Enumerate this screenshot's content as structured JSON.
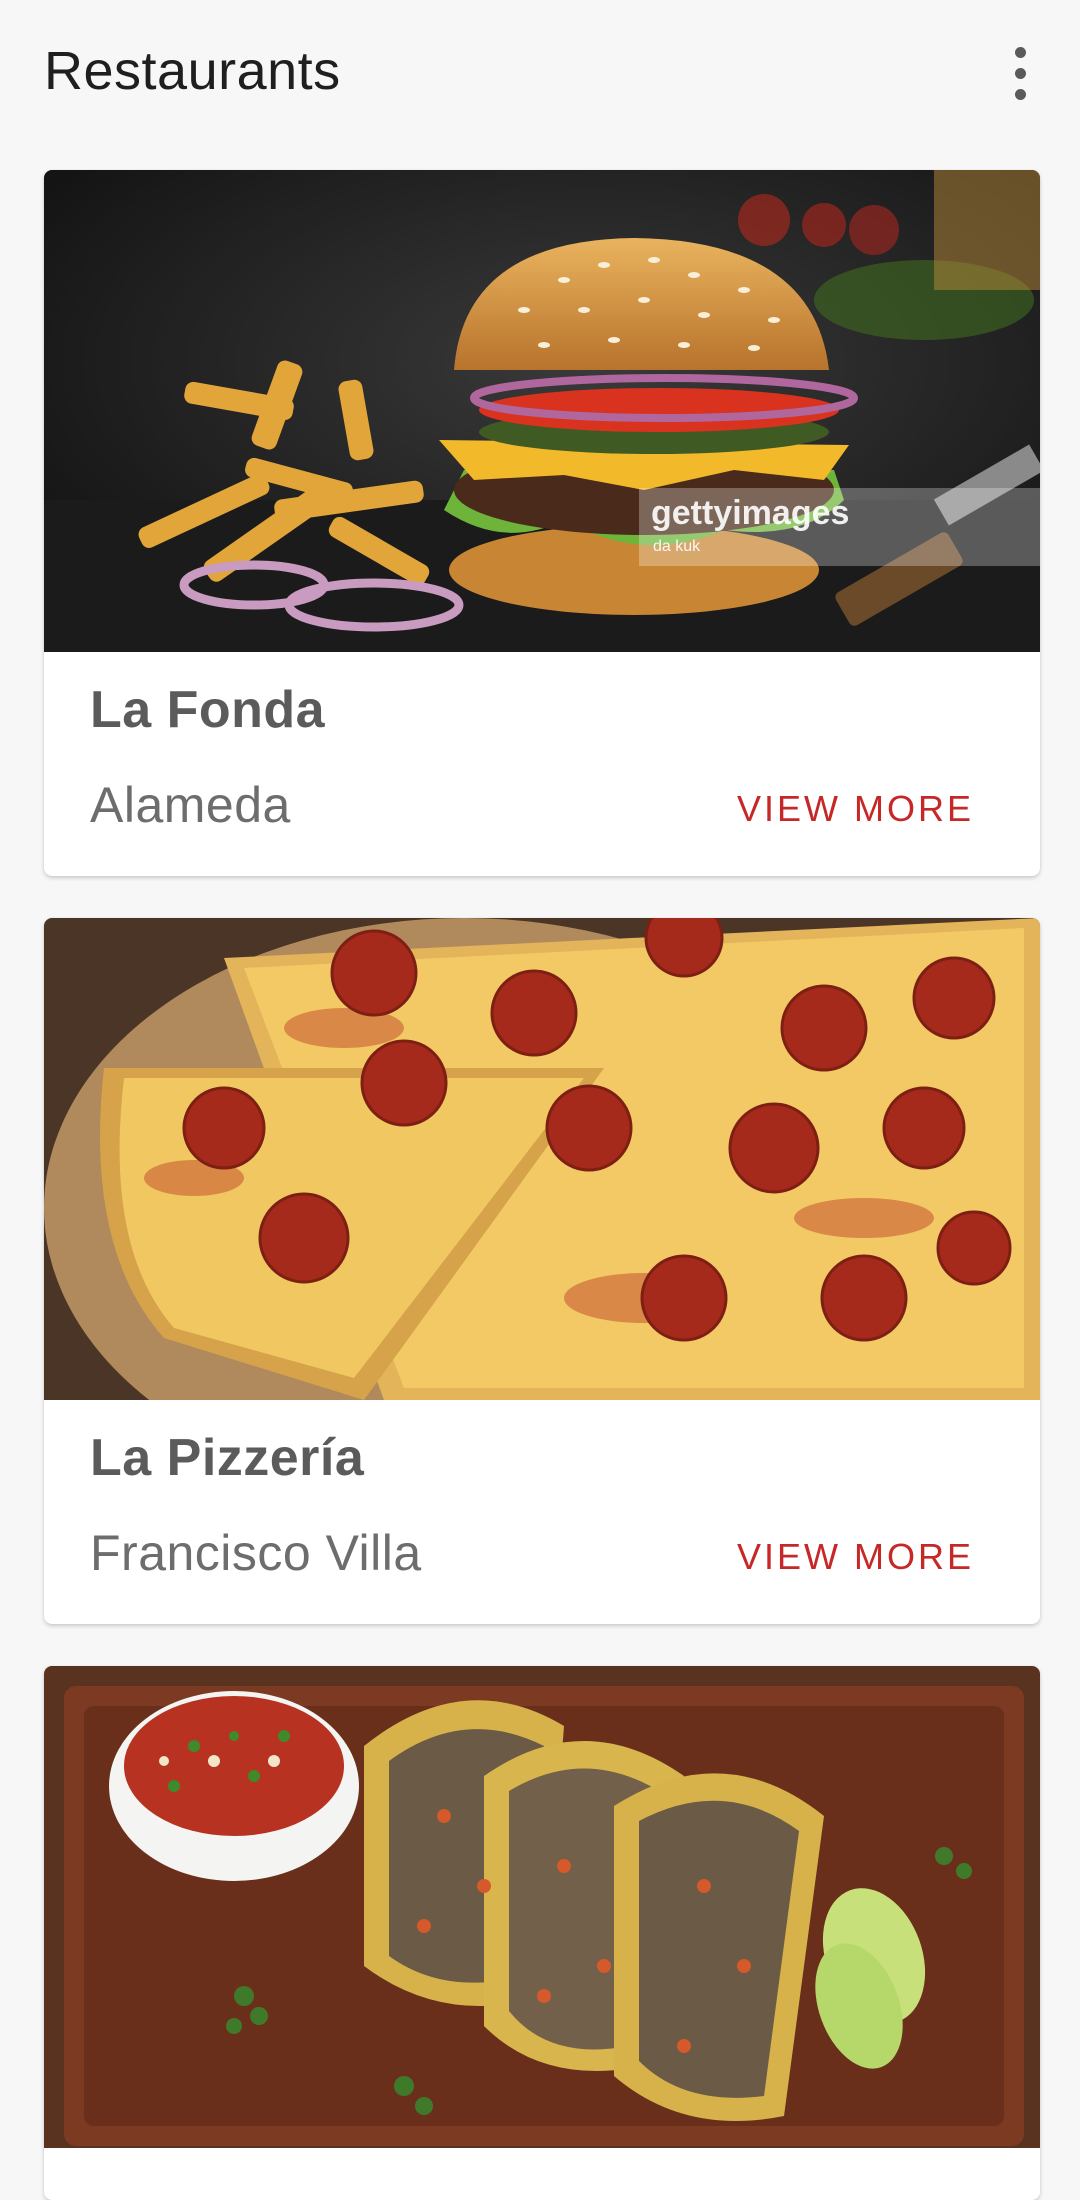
{
  "app_bar": {
    "title": "Restaurants",
    "overflow_icon": "more-vert-icon"
  },
  "restaurants": [
    {
      "name": "La Fonda",
      "location": "Alameda",
      "action": "VIEW MORE",
      "image": "burger-with-fries-photo",
      "watermark": {
        "brand": "gettyimages",
        "credit": "da kuk"
      }
    },
    {
      "name": "La Pizzería",
      "location": "Francisco Villa",
      "action": "VIEW MORE",
      "image": "pepperoni-pizza-photo"
    },
    {
      "image": "tacos-with-salsa-photo"
    }
  ],
  "colors": {
    "background": "#f7f7f7",
    "card": "#ffffff",
    "accent": "#c62828",
    "title_text": "#1f1f1f",
    "name_text": "#5b5b5b",
    "secondary_text": "#6d6d6d"
  }
}
